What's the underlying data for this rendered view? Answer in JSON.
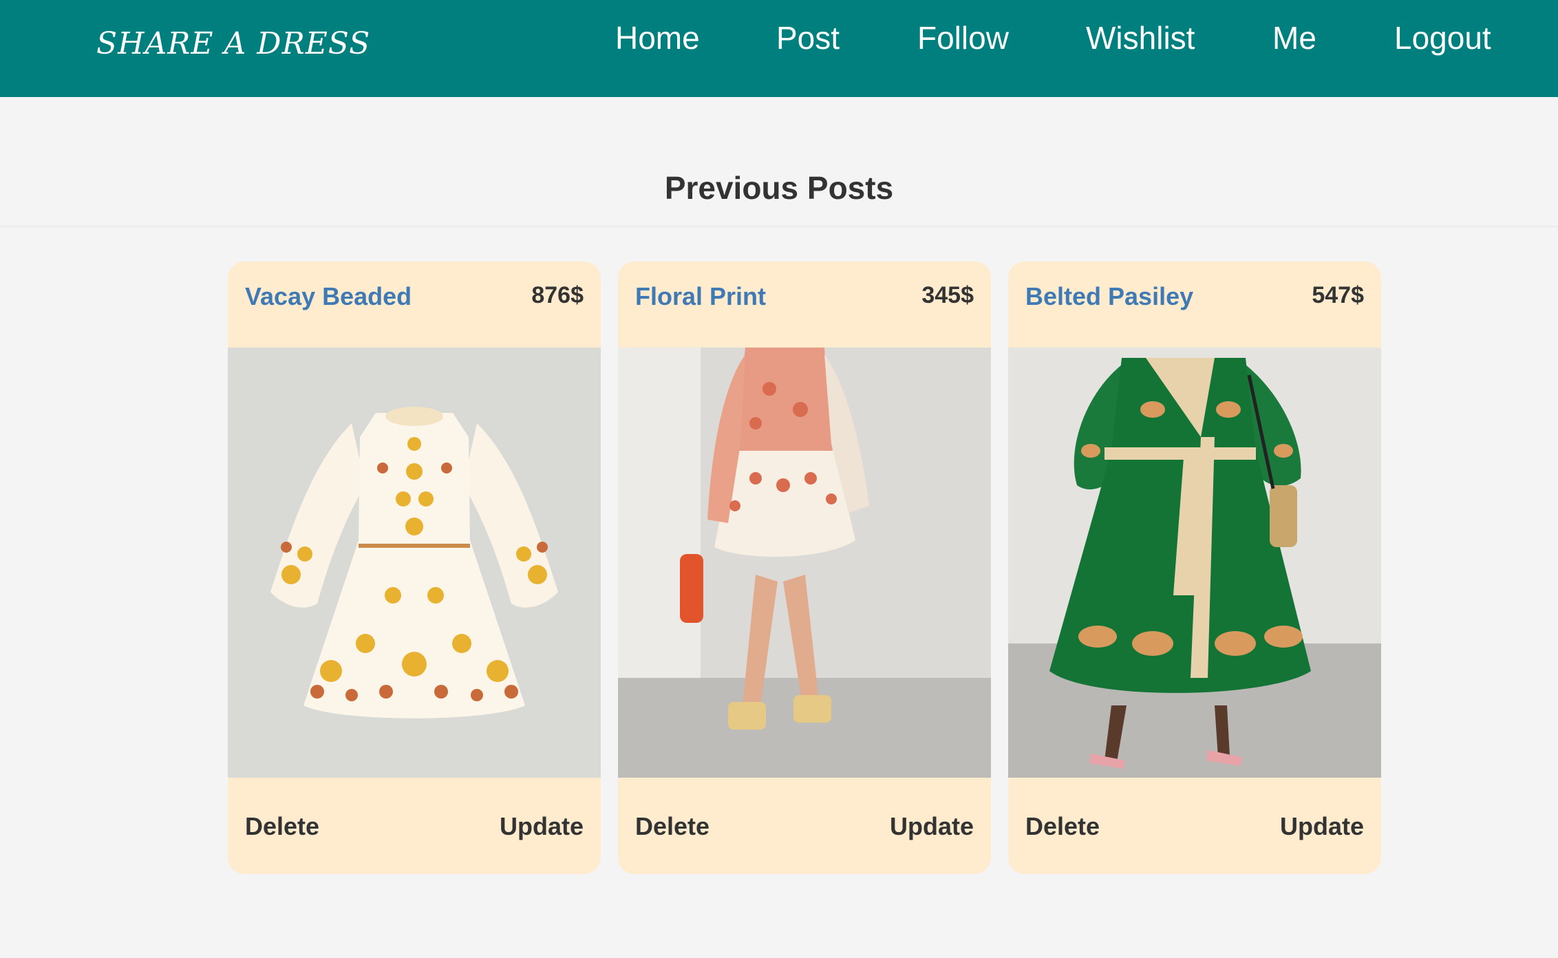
{
  "header": {
    "brand": "SHARE A DRESS",
    "nav": [
      "Home",
      "Post",
      "Follow",
      "Wishlist",
      "Me",
      "Logout"
    ]
  },
  "main": {
    "title": "Previous Posts",
    "posts": [
      {
        "title": "Vacay Beaded",
        "price": "876$",
        "delete_label": "Delete",
        "update_label": "Update"
      },
      {
        "title": "Floral Print",
        "price": "345$",
        "delete_label": "Delete",
        "update_label": "Update"
      },
      {
        "title": "Belted Pasiley",
        "price": "547$",
        "delete_label": "Delete",
        "update_label": "Update"
      }
    ]
  },
  "colors": {
    "navbar": "#007f7f",
    "card_background": "#ffebcd",
    "post_title": "#3f7ab5",
    "page_background": "#f4f4f4"
  }
}
